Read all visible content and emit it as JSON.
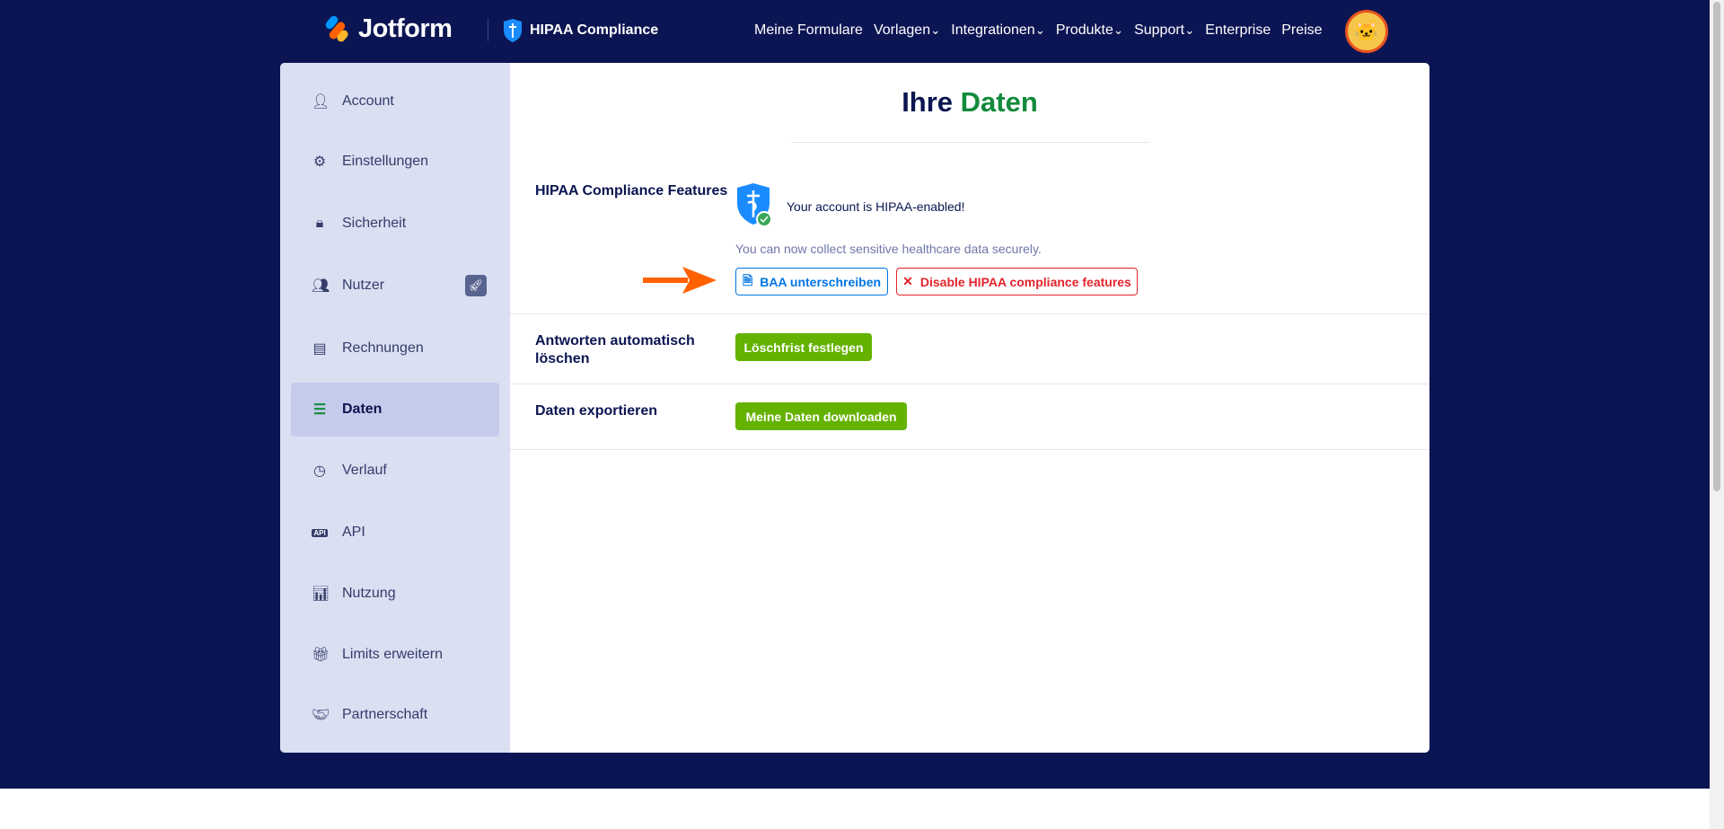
{
  "header": {
    "brand": "Jotform",
    "hipaa_label": "HIPAA Compliance",
    "nav": [
      "Meine Formulare",
      "Vorlagen",
      "Integrationen",
      "Produkte",
      "Support",
      "Enterprise",
      "Preise"
    ],
    "nav_dropdowns": [
      false,
      true,
      true,
      true,
      true,
      false,
      false
    ]
  },
  "sidebar": {
    "items": [
      {
        "label": "Account",
        "icon": "user-icon"
      },
      {
        "label": "Einstellungen",
        "icon": "gear-icon"
      },
      {
        "label": "Sicherheit",
        "icon": "lock-icon"
      },
      {
        "label": "Nutzer",
        "icon": "users-icon"
      },
      {
        "label": "Rechnungen",
        "icon": "invoice-icon"
      },
      {
        "label": "Daten",
        "icon": "database-icon",
        "active": true
      },
      {
        "label": "Verlauf",
        "icon": "history-icon"
      },
      {
        "label": "API",
        "icon": "api-icon"
      },
      {
        "label": "Nutzung",
        "icon": "bar-chart-icon"
      },
      {
        "label": "Limits erweitern",
        "icon": "gift-icon"
      },
      {
        "label": "Partnerschaft",
        "icon": "handshake-icon"
      }
    ]
  },
  "main": {
    "title_part1": "Ihre",
    "title_part2": "Daten",
    "hipaa": {
      "label": "HIPAA Compliance Features",
      "status": "Your account is HIPAA-enabled!",
      "subtext": "You can now collect sensitive healthcare data securely.",
      "baa_button": "BAA unterschreiben",
      "disable_button": "Disable HIPAA compliance features"
    },
    "auto_delete": {
      "label": "Antworten automatisch löschen",
      "button": "Löschfrist festlegen"
    },
    "export": {
      "label": "Daten exportieren",
      "button": "Meine Daten downloaden"
    }
  },
  "colors": {
    "navy": "#0c1553",
    "green": "#64b200",
    "accent_blue": "#0075e3",
    "danger": "#e3242b",
    "arrow": "#ff6100"
  }
}
